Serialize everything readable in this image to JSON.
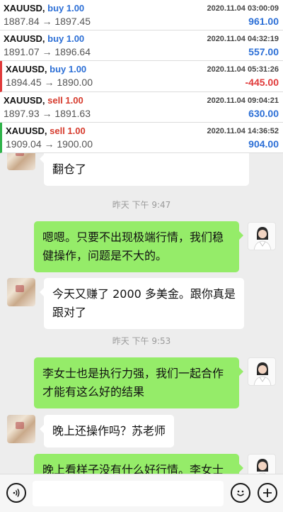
{
  "trades": [
    {
      "symbol": "XAUUSD",
      "side": "buy 1.00",
      "side_type": "buy",
      "prices": "1887.84 → 1897.45",
      "time": "2020.11.04 03:00:09",
      "pnl": "961.00",
      "pnl_type": "pos",
      "mark": ""
    },
    {
      "symbol": "XAUUSD",
      "side": "buy 1.00",
      "side_type": "buy",
      "prices": "1891.07 → 1896.64",
      "time": "2020.11.04 04:32:19",
      "pnl": "557.00",
      "pnl_type": "pos",
      "mark": ""
    },
    {
      "symbol": "XAUUSD",
      "side": "buy 1.00",
      "side_type": "buy",
      "prices": "1894.45 → 1890.00",
      "time": "2020.11.04 05:31:26",
      "pnl": "-445.00",
      "pnl_type": "neg",
      "mark": "red"
    },
    {
      "symbol": "XAUUSD",
      "side": "sell 1.00",
      "side_type": "sell",
      "prices": "1897.93 → 1891.63",
      "time": "2020.11.04 09:04:21",
      "pnl": "630.00",
      "pnl_type": "pos",
      "mark": ""
    },
    {
      "symbol": "XAUUSD",
      "side": "sell 1.00",
      "side_type": "sell",
      "prices": "1909.04 → 1900.00",
      "time": "2020.11.04 14:36:52",
      "pnl": "904.00",
      "pnl_type": "pos",
      "mark": "green"
    }
  ],
  "messages": {
    "m0": "翻仓了",
    "ts1": "昨天 下午 9:47",
    "m1": "嗯嗯。只要不出现极端行情，我们稳健操作，问题是不大的。",
    "m2": "今天又赚了 2000 多美金。跟你真是跟对了",
    "ts2": "昨天 下午 9:53",
    "m3": "李女士也是执行力强，我们一起合作才能有这么好的结果",
    "m4": "晚上还操作吗？苏老师",
    "m5": "晚上看样子没有什么好行情。李女士"
  },
  "icons": {
    "voice": "voice-icon",
    "emoji": "emoji-icon",
    "plus": "plus-icon"
  },
  "colors": {
    "buy": "#2c6fd6",
    "sell": "#d63a2c",
    "bubble_green": "#95ec69"
  }
}
